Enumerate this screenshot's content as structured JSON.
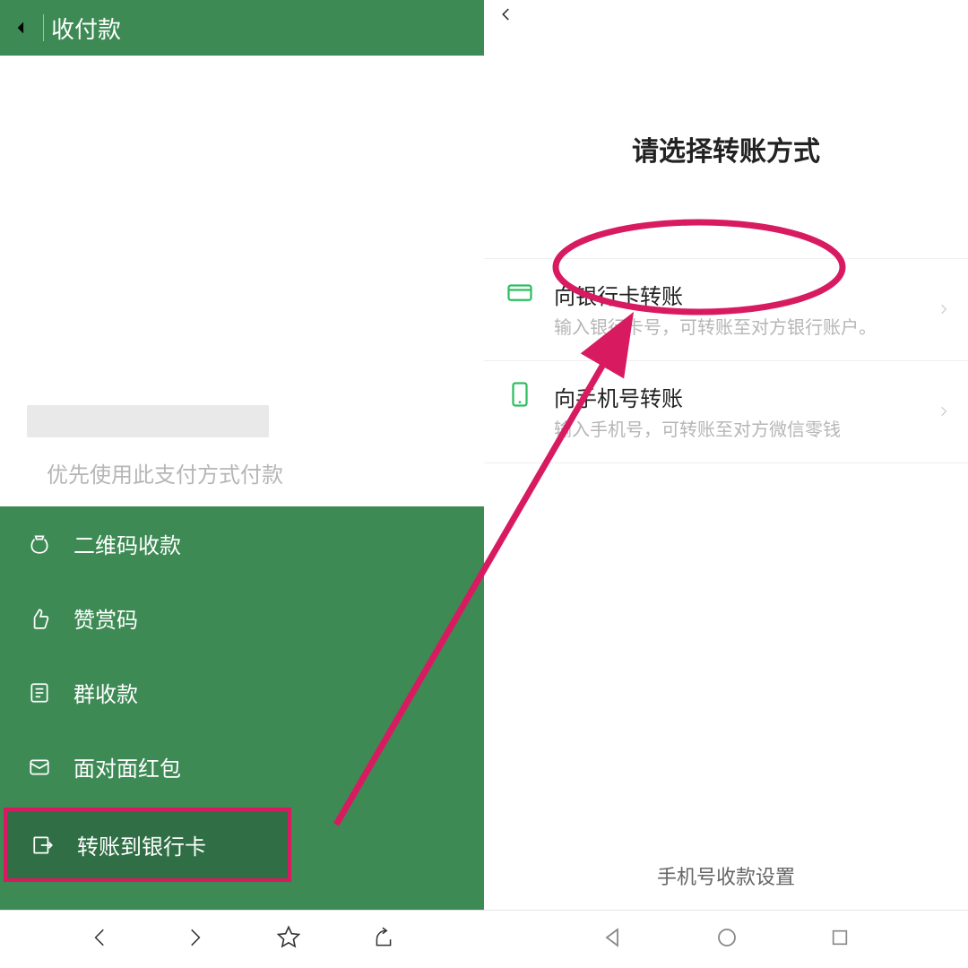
{
  "left": {
    "header_title": "收付款",
    "payment_hint": "优先使用此支付方式付款",
    "menu": [
      {
        "label": "二维码收款"
      },
      {
        "label": "赞赏码"
      },
      {
        "label": "群收款"
      },
      {
        "label": "面对面红包"
      },
      {
        "label": "转账到银行卡"
      }
    ]
  },
  "right": {
    "title": "请选择转账方式",
    "options": [
      {
        "label": "向银行卡转账",
        "desc": "输入银行卡号，可转账至对方银行账户。"
      },
      {
        "label": "向手机号转账",
        "desc": "输入手机号，可转账至对方微信零钱"
      }
    ],
    "footer": "手机号收款设置"
  },
  "annotation_color": "#d81b60"
}
